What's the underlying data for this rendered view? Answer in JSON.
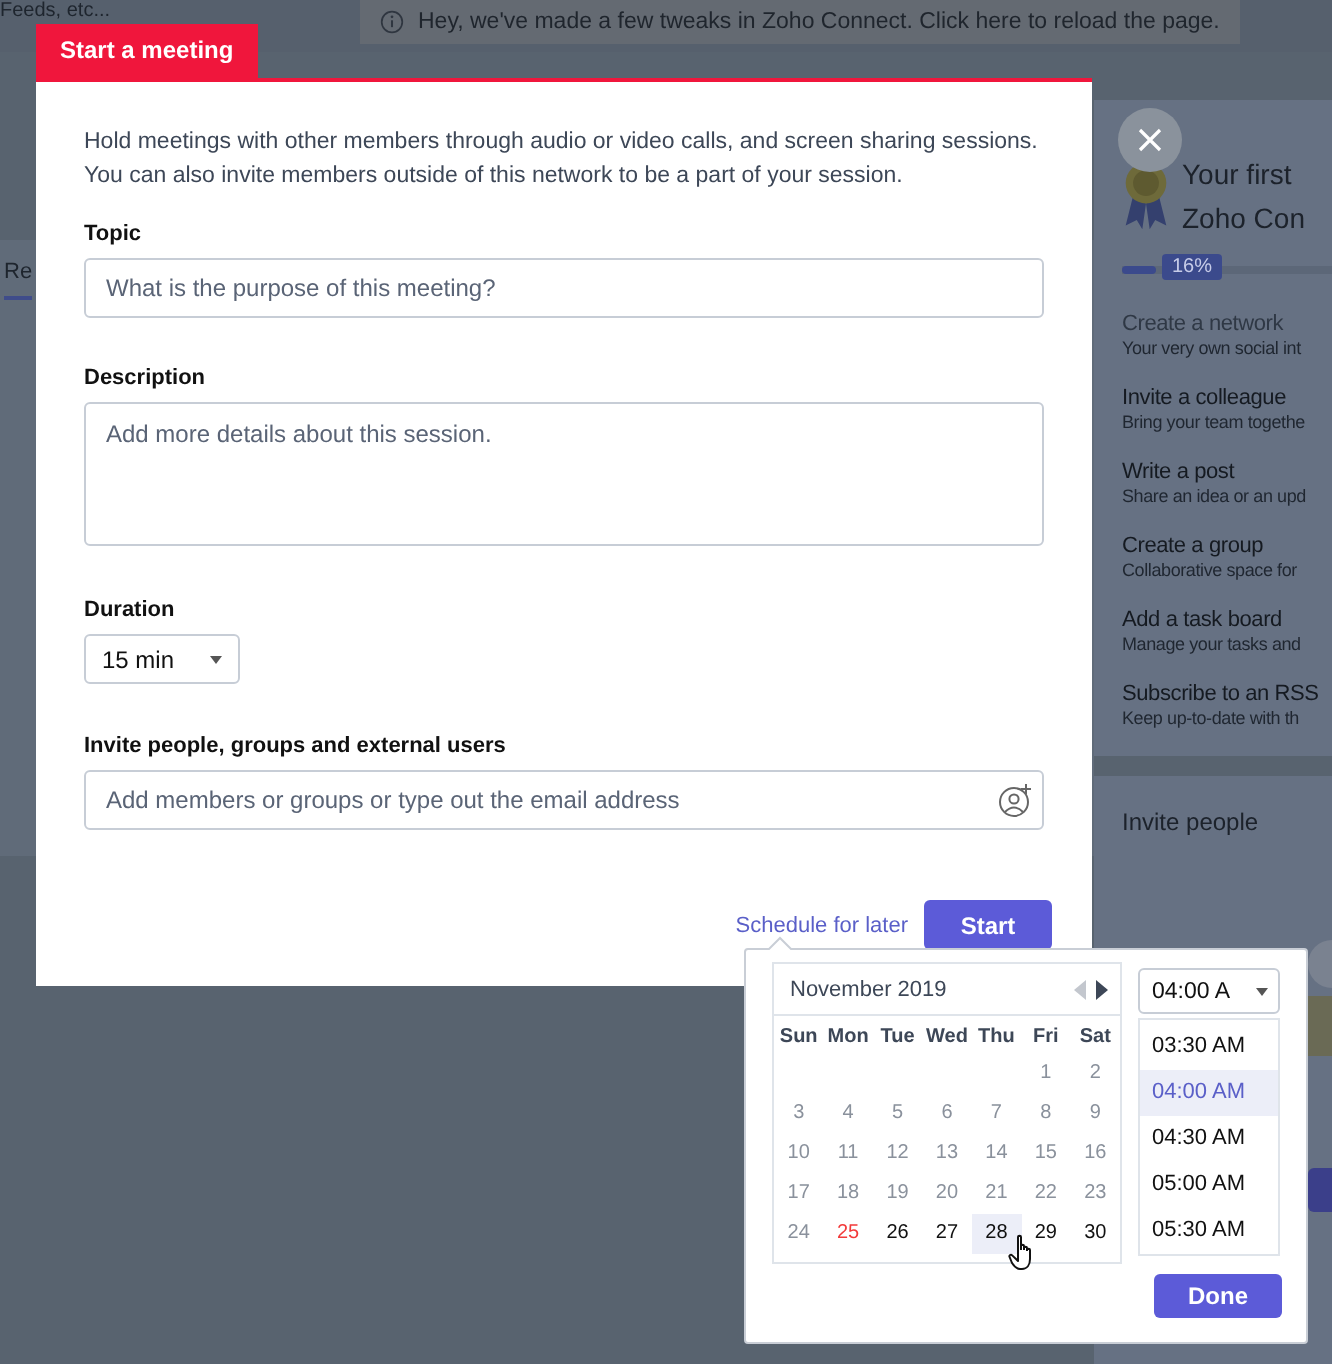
{
  "background": {
    "search_hint": "Feeds, etc...",
    "notice": "Hey, we've made a few tweaks in Zoho Connect. Click here to reload the page.",
    "tab_fragment": "Re",
    "onboarding": {
      "title_lines": [
        "Your first",
        "Zoho Con"
      ],
      "level": 0.16,
      "percent": "16%",
      "steps": [
        {
          "title": "Create a network",
          "subtitle": "Your very own social int",
          "done": true
        },
        {
          "title": "Invite a colleague",
          "subtitle": "Bring your team togethe",
          "done": false
        },
        {
          "title": "Write a post",
          "subtitle": "Share an idea or an upd",
          "done": false
        },
        {
          "title": "Create a group",
          "subtitle": "Collaborative space for",
          "done": false
        },
        {
          "title": "Add a task board",
          "subtitle": "Manage your tasks and",
          "done": false
        },
        {
          "title": "Subscribe to an RSS",
          "subtitle": "Keep up-to-date with th",
          "done": false
        }
      ]
    },
    "invite_panel": {
      "title": "Invite people"
    }
  },
  "dialog": {
    "tab": "Start a meeting",
    "intro": "Hold meetings with other members through audio or video calls, and screen sharing sessions. You can also invite members outside of this network to be a part of your session.",
    "topic": {
      "label": "Topic",
      "placeholder": "What is the purpose of this meeting?"
    },
    "description": {
      "label": "Description",
      "placeholder": "Add more details about this session."
    },
    "duration": {
      "label": "Duration",
      "value": "15 min"
    },
    "invite": {
      "label": "Invite people, groups and external users",
      "placeholder": "Add members or groups or type out the email address"
    },
    "schedule_link": "Schedule for later",
    "start_button": "Start"
  },
  "scheduler": {
    "month": "November 2019",
    "weekdays": [
      "Sun",
      "Mon",
      "Tue",
      "Wed",
      "Thu",
      "Fri",
      "Sat"
    ],
    "weeks": [
      {
        "days": [
          {
            "label": "1",
            "kind": "past",
            "selected": false
          },
          {
            "label": "2",
            "kind": "past",
            "selected": false
          }
        ]
      },
      {
        "days": [
          {
            "label": "3",
            "kind": "past",
            "selected": false
          },
          {
            "label": "4",
            "kind": "past",
            "selected": false
          },
          {
            "label": "5",
            "kind": "past",
            "selected": false
          },
          {
            "label": "6",
            "kind": "past",
            "selected": false
          },
          {
            "label": "7",
            "kind": "past",
            "selected": false
          },
          {
            "label": "8",
            "kind": "past",
            "selected": false
          },
          {
            "label": "9",
            "kind": "past",
            "selected": false
          }
        ]
      },
      {
        "days": [
          {
            "label": "10",
            "kind": "past",
            "selected": false
          },
          {
            "label": "11",
            "kind": "past",
            "selected": false
          },
          {
            "label": "12",
            "kind": "past",
            "selected": false
          },
          {
            "label": "13",
            "kind": "past",
            "selected": false
          },
          {
            "label": "14",
            "kind": "past",
            "selected": false
          },
          {
            "label": "15",
            "kind": "past",
            "selected": false
          },
          {
            "label": "16",
            "kind": "past",
            "selected": false
          }
        ]
      },
      {
        "days": [
          {
            "label": "17",
            "kind": "past",
            "selected": false
          },
          {
            "label": "18",
            "kind": "past",
            "selected": false
          },
          {
            "label": "19",
            "kind": "past",
            "selected": false
          },
          {
            "label": "20",
            "kind": "past",
            "selected": false
          },
          {
            "label": "21",
            "kind": "past",
            "selected": false
          },
          {
            "label": "22",
            "kind": "past",
            "selected": false
          },
          {
            "label": "23",
            "kind": "past",
            "selected": false
          }
        ]
      },
      {
        "days": [
          {
            "label": "24",
            "kind": "past",
            "selected": false
          },
          {
            "label": "25",
            "kind": "today",
            "selected": false
          },
          {
            "label": "26",
            "kind": "future",
            "selected": false
          },
          {
            "label": "27",
            "kind": "future",
            "selected": false
          },
          {
            "label": "28",
            "kind": "future",
            "selected": true
          },
          {
            "label": "29",
            "kind": "future",
            "selected": false
          },
          {
            "label": "30",
            "kind": "future",
            "selected": false
          }
        ]
      }
    ],
    "time_value": "04:00 A",
    "times": [
      {
        "label": "03:30 AM",
        "selected": false
      },
      {
        "label": "04:00 AM",
        "selected": true
      },
      {
        "label": "04:30 AM",
        "selected": false
      },
      {
        "label": "05:00 AM",
        "selected": false
      },
      {
        "label": "05:30 AM",
        "selected": false
      }
    ],
    "done_button": "Done"
  }
}
